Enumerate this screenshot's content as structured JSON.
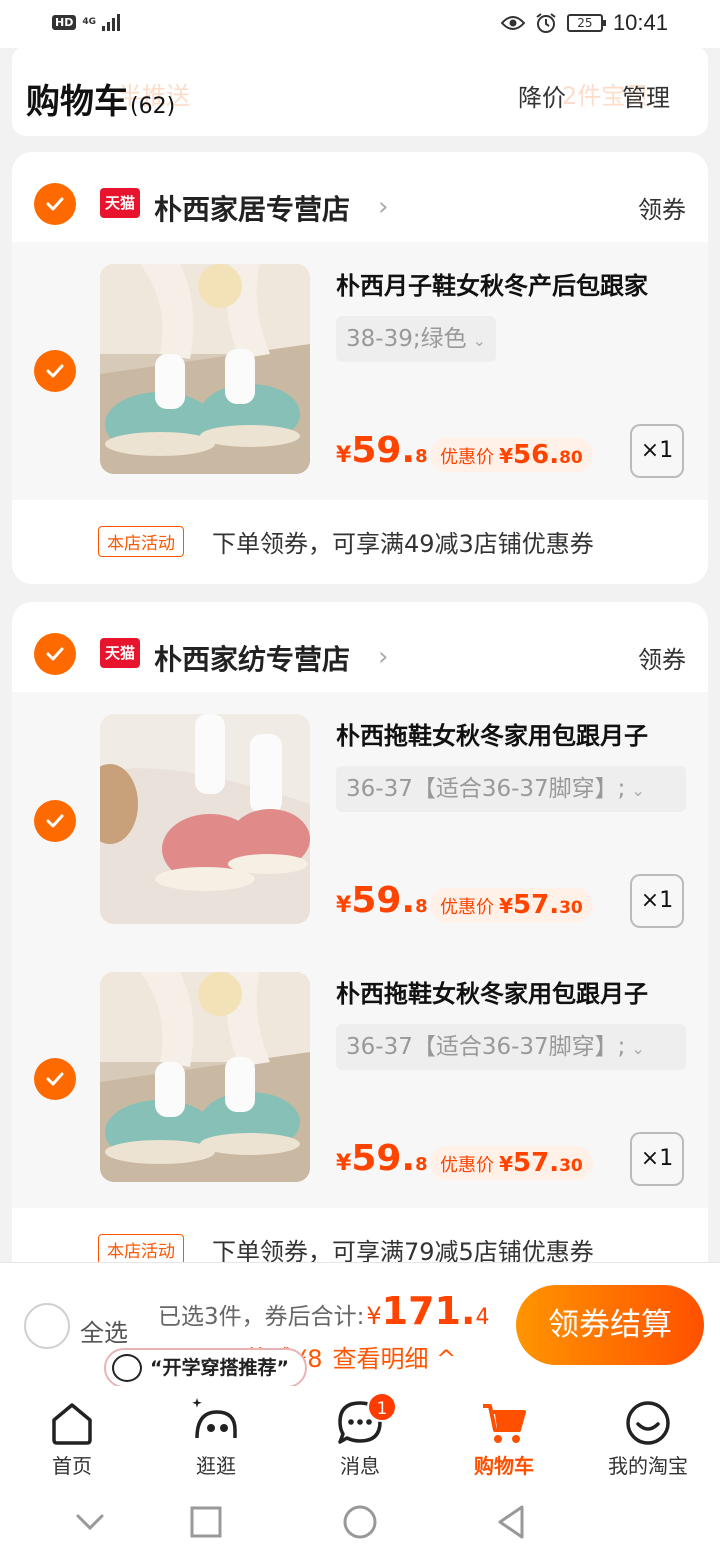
{
  "status": {
    "hd": "HD",
    "network": "4G",
    "battery": "25",
    "time": "10:41"
  },
  "header": {
    "title": "购物车",
    "count": "(62)",
    "price_drop": "降价",
    "manage": "管理",
    "ghost_left": "半推送",
    "ghost_right": "2件宝贝"
  },
  "stores": [
    {
      "badge": "天猫",
      "name": "朴西家居专营店",
      "coupon": "领券",
      "items": [
        {
          "title": "朴西月子鞋女秋冬产后包跟家",
          "sku": "38-39;绿色",
          "price_int": "59.",
          "price_dec": "8",
          "promo_label": "优惠价",
          "promo_int": "56.",
          "promo_dec": "80",
          "qty": "×1",
          "image": "green-slippers"
        }
      ],
      "activity_tag": "本店活动",
      "activity_text": "下单领券，可享满49减3店铺优惠券"
    },
    {
      "badge": "天猫",
      "name": "朴西家纺专营店",
      "coupon": "领券",
      "items": [
        {
          "title": "朴西拖鞋女秋冬家用包跟月子",
          "sku": "36-37【适合36-37脚穿】;",
          "price_int": "59.",
          "price_dec": "8",
          "promo_label": "优惠价",
          "promo_int": "57.",
          "promo_dec": "30",
          "qty": "×1",
          "image": "pink-slippers"
        },
        {
          "title": "朴西拖鞋女秋冬家用包跟月子",
          "sku": "36-37【适合36-37脚穿】;",
          "price_int": "59.",
          "price_dec": "8",
          "promo_label": "优惠价",
          "promo_int": "57.",
          "promo_dec": "30",
          "qty": "×1",
          "image": "green-slippers"
        }
      ],
      "activity_tag": "本店活动",
      "activity_text": "下单领券，可享满79减5店铺优惠券"
    }
  ],
  "currency": "¥",
  "checkout": {
    "select_all": "全选",
    "selected_label": "已选3件，券后合计:",
    "total_int": "171.",
    "total_dec": "4",
    "savings": "共减¥8",
    "details": "查看明细 ^",
    "button": "领券结算",
    "promo_bubble": "“开学穿搭推荐”"
  },
  "tabs": [
    {
      "label": "首页",
      "icon": "home-icon",
      "active": false
    },
    {
      "label": "逛逛",
      "icon": "browse-icon",
      "active": false
    },
    {
      "label": "消息",
      "icon": "message-icon",
      "active": false,
      "badge": "1"
    },
    {
      "label": "购物车",
      "icon": "cart-icon",
      "active": true
    },
    {
      "label": "我的淘宝",
      "icon": "profile-icon",
      "active": false
    }
  ],
  "colors": {
    "accent": "#ff5000",
    "price": "#ff4400",
    "tmall": "#e8132d"
  }
}
